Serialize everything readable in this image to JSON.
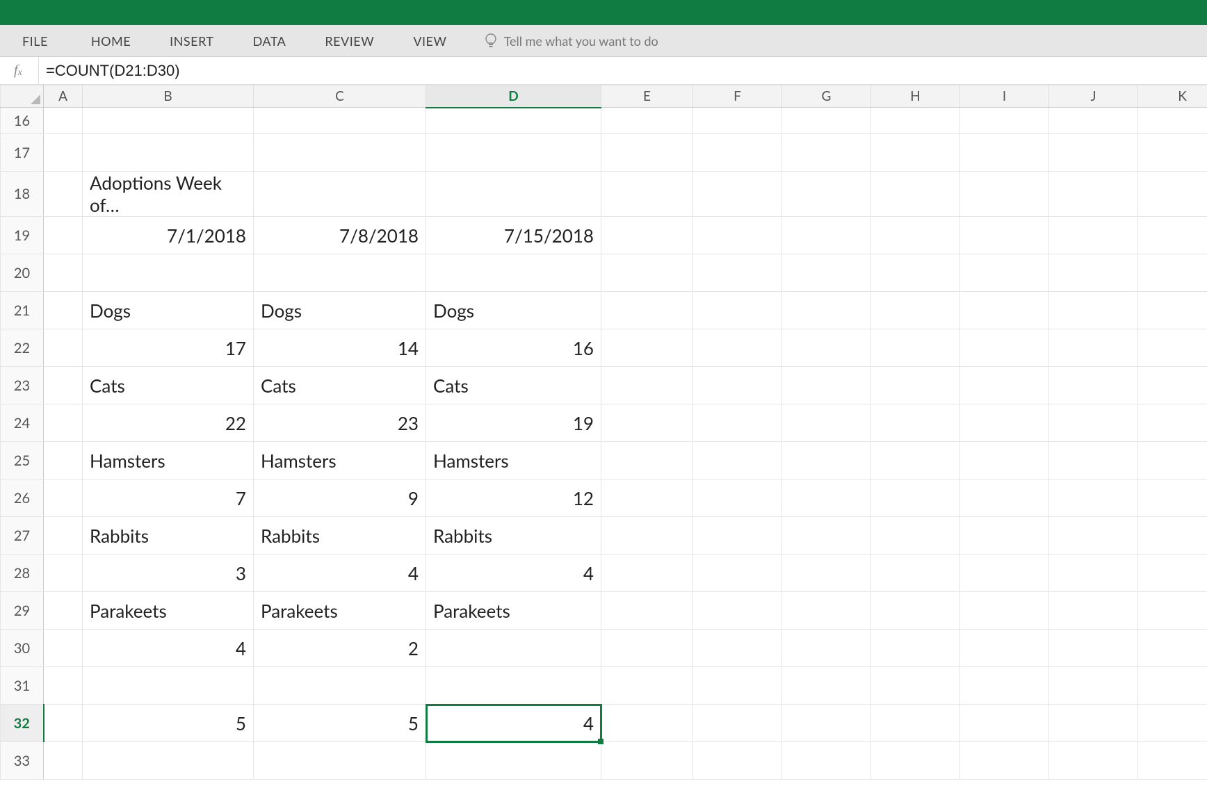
{
  "ribbon": {
    "tabs": [
      "FILE",
      "HOME",
      "INSERT",
      "DATA",
      "REVIEW",
      "VIEW"
    ],
    "tell_me_placeholder": "Tell me what you want to do"
  },
  "formula_bar": {
    "fx": "fx",
    "value": "=COUNT(D21:D30)"
  },
  "columns": [
    "A",
    "B",
    "C",
    "D",
    "E",
    "F",
    "G",
    "H",
    "I",
    "J",
    "K"
  ],
  "active_col": "D",
  "active_row": "32",
  "rows": {
    "16": {
      "A": "",
      "B": "",
      "C": "",
      "D": ""
    },
    "17": {
      "A": "",
      "B": "",
      "C": "",
      "D": ""
    },
    "18": {
      "A": "",
      "B": "Adoptions Week of…",
      "C": "",
      "D": ""
    },
    "19": {
      "A": "",
      "B": "7/1/2018",
      "C": "7/8/2018",
      "D": "7/15/2018"
    },
    "20": {
      "A": "",
      "B": "",
      "C": "",
      "D": ""
    },
    "21": {
      "A": "",
      "B": "Dogs",
      "C": "Dogs",
      "D": "Dogs"
    },
    "22": {
      "A": "",
      "B": "17",
      "C": "14",
      "D": "16"
    },
    "23": {
      "A": "",
      "B": "Cats",
      "C": "Cats",
      "D": "Cats"
    },
    "24": {
      "A": "",
      "B": "22",
      "C": "23",
      "D": "19"
    },
    "25": {
      "A": "",
      "B": "Hamsters",
      "C": "Hamsters",
      "D": "Hamsters"
    },
    "26": {
      "A": "",
      "B": "7",
      "C": "9",
      "D": "12"
    },
    "27": {
      "A": "",
      "B": "Rabbits",
      "C": "Rabbits",
      "D": "Rabbits"
    },
    "28": {
      "A": "",
      "B": "3",
      "C": "4",
      "D": "4"
    },
    "29": {
      "A": "",
      "B": "Parakeets",
      "C": "Parakeets",
      "D": "Parakeets"
    },
    "30": {
      "A": "",
      "B": "4",
      "C": "2",
      "D": ""
    },
    "31": {
      "A": "",
      "B": "",
      "C": "",
      "D": ""
    },
    "32": {
      "A": "",
      "B": "5",
      "C": "5",
      "D": "4"
    },
    "33": {
      "A": "",
      "B": "",
      "C": "",
      "D": ""
    }
  }
}
